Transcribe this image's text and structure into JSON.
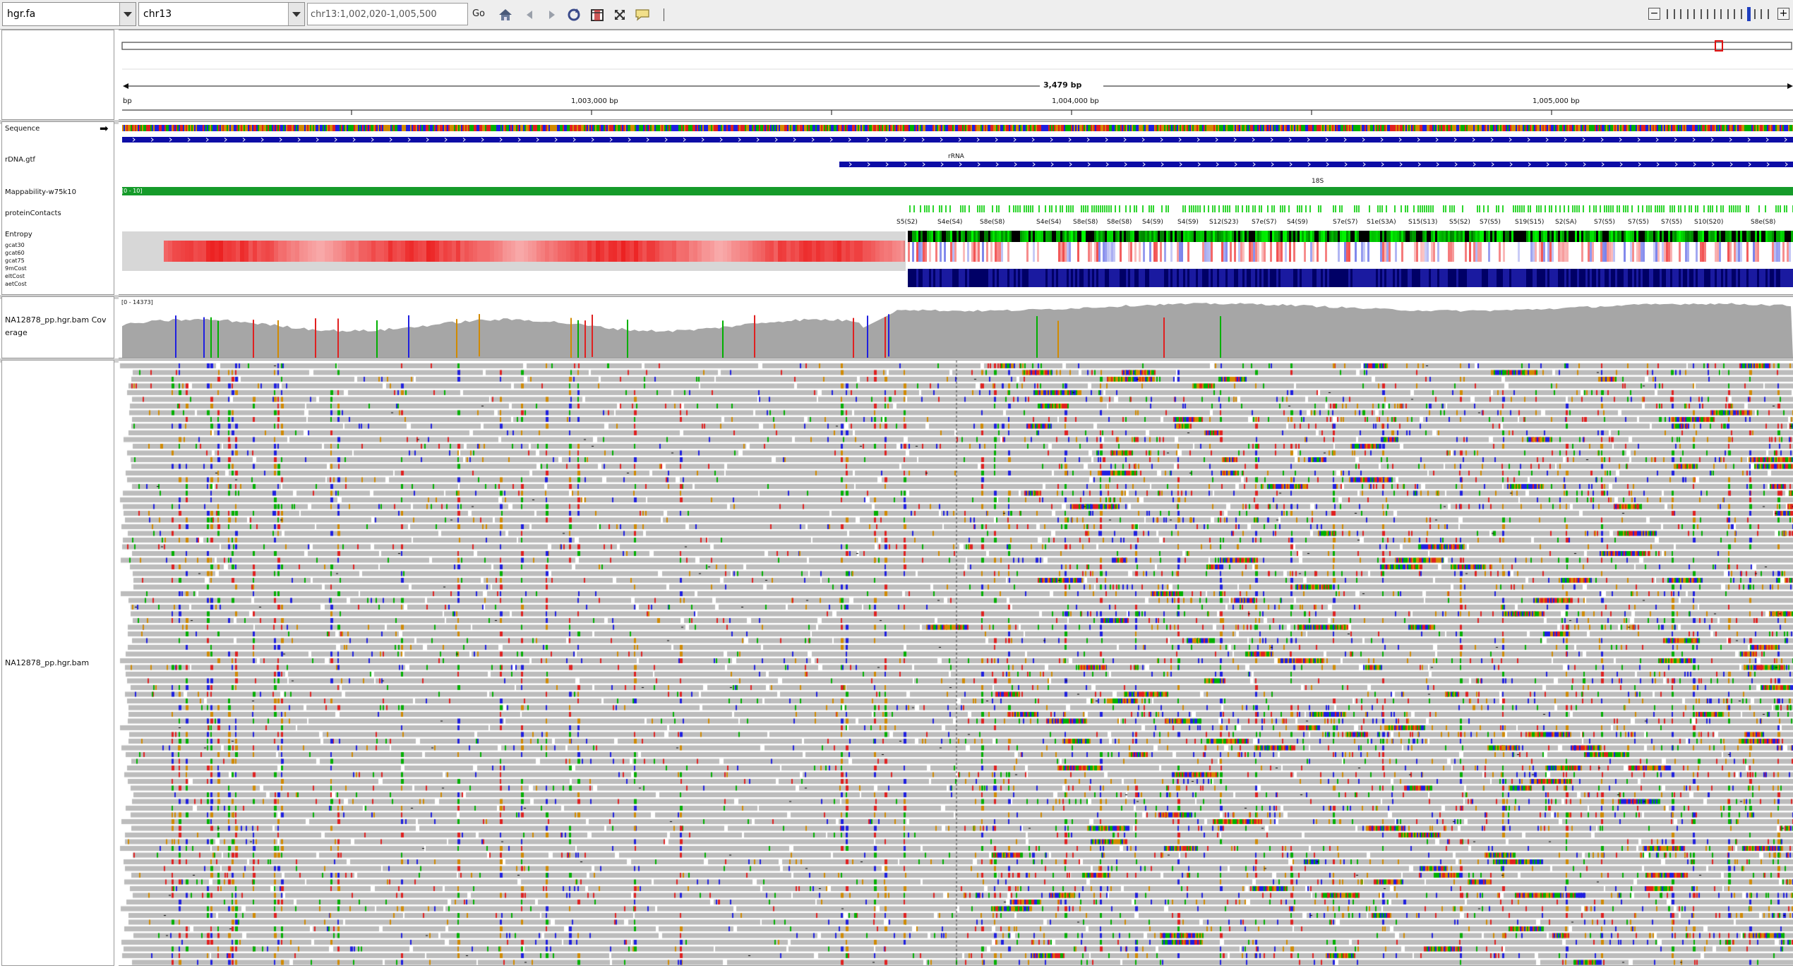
{
  "toolbar": {
    "genome": "hgr.fa",
    "chromosome": "chr13",
    "locus": "chr13:1,002,020-1,005,500",
    "go_label": "Go",
    "icons": [
      "home-icon",
      "back-icon",
      "forward-icon",
      "refresh-icon",
      "roi-icon",
      "resize-icon",
      "popup-text-icon"
    ],
    "zoom_minus": "−",
    "zoom_plus": "+"
  },
  "ruler": {
    "span_label": "3,479 bp",
    "start_label": "bp",
    "ticks": [
      "1,003,000 bp",
      "1,004,000 bp",
      "1,005,000 bp"
    ]
  },
  "tracks": {
    "sequence": {
      "label": "Sequence",
      "arrow": "➡"
    },
    "gtf": {
      "label": "rDNA.gtf",
      "feature_1": "rRNA",
      "feature_2": "18S"
    },
    "mappability": {
      "label": "Mappability-w75k10",
      "range": "[0 - 10]"
    },
    "protein_contacts": {
      "label": "proteinContacts",
      "features": [
        "S5(S2)",
        "S4e(S4)",
        "S8e(S8)",
        "S4e(S4)",
        "S8e(S8)",
        "S8e(S8)",
        "S4(S9)",
        "S4(S9)",
        "S12(S23)",
        "S7e(S7)",
        "S4(S9)",
        "S7e(S7)",
        "S1e(S3A)",
        "S15(S13)",
        "S5(S2)",
        "S7(S5)",
        "S19(S15)",
        "S2(SA)",
        "S7(S5)",
        "S7(S5)",
        "S7(S5)",
        "S10(S20)",
        "S8e(S8)"
      ]
    },
    "entropy": {
      "label": "Entropy",
      "sublabels": [
        "gcat30",
        "gcat60",
        "gcat75",
        "9mCost",
        "eltCost",
        "aetCost"
      ]
    },
    "coverage": {
      "label": "NA12878_pp.hgr.bam Coverage",
      "range": "[0 - 14373]"
    },
    "alignments": {
      "label": "NA12878_pp.hgr.bam"
    }
  },
  "colors": {
    "seq_A": "#00b000",
    "seq_C": "#1f1fe0",
    "seq_G": "#d18a00",
    "seq_T": "#e02020",
    "gtf": "#0d0da6",
    "mappability": "#159b2a",
    "coverage": "#a6a6a6",
    "read": "#bcbcbc"
  }
}
